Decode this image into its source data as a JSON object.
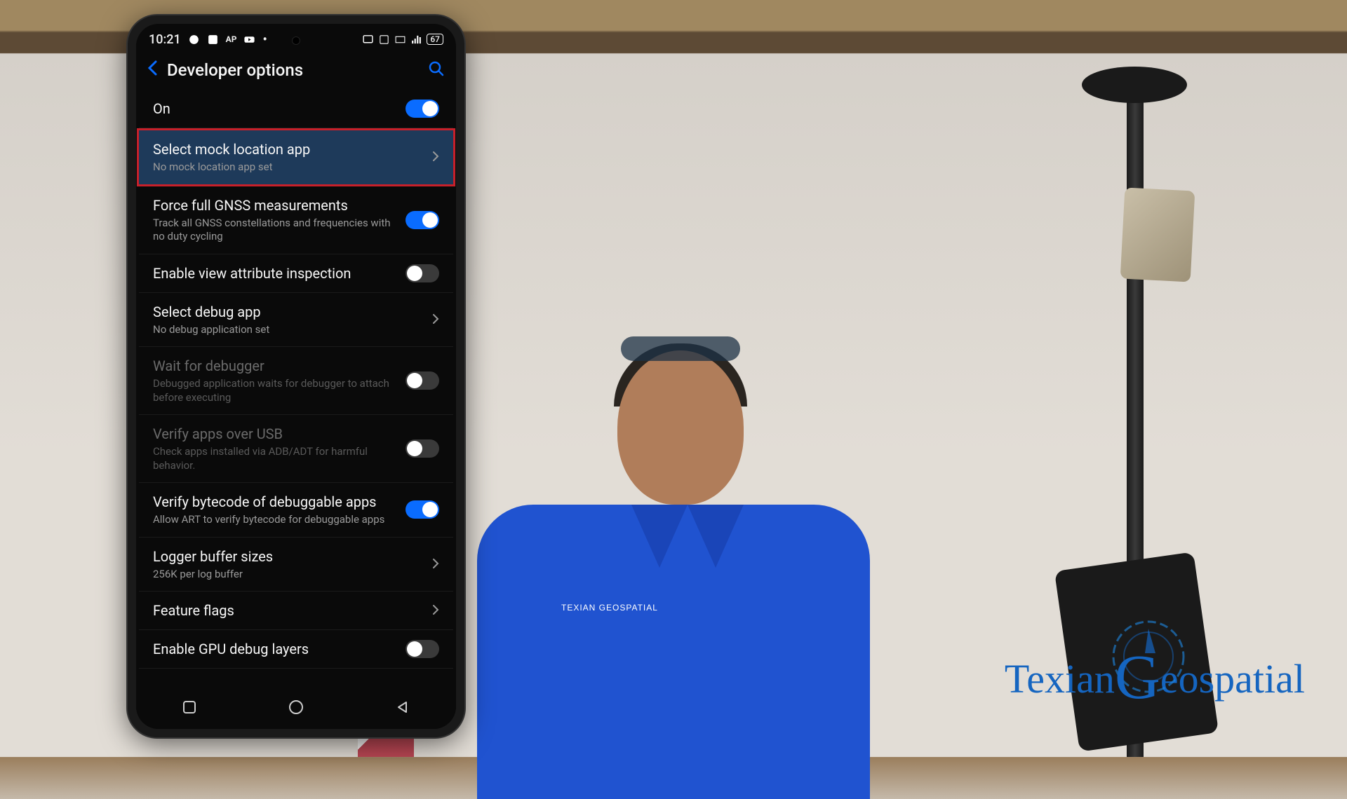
{
  "status_bar": {
    "time": "10:21",
    "battery": "67"
  },
  "header": {
    "title": "Developer options"
  },
  "settings": [
    {
      "title": "On",
      "sub": "",
      "control": "toggle",
      "state": "on",
      "disabled": false,
      "highlight": false
    },
    {
      "title": "Select mock location app",
      "sub": "No mock location app set",
      "control": "chevron",
      "state": "",
      "disabled": false,
      "highlight": true
    },
    {
      "title": "Force full GNSS measurements",
      "sub": "Track all GNSS constellations and frequencies with no duty cycling",
      "control": "toggle",
      "state": "on",
      "disabled": false,
      "highlight": false
    },
    {
      "title": "Enable view attribute inspection",
      "sub": "",
      "control": "toggle",
      "state": "off",
      "disabled": false,
      "highlight": false
    },
    {
      "title": "Select debug app",
      "sub": "No debug application set",
      "control": "chevron",
      "state": "",
      "disabled": false,
      "highlight": false
    },
    {
      "title": "Wait for debugger",
      "sub": "Debugged application waits for debugger to attach before executing",
      "control": "toggle",
      "state": "off",
      "disabled": true,
      "highlight": false
    },
    {
      "title": "Verify apps over USB",
      "sub": "Check apps installed via ADB/ADT for harmful behavior.",
      "control": "toggle",
      "state": "off",
      "disabled": true,
      "highlight": false
    },
    {
      "title": "Verify bytecode of debuggable apps",
      "sub": "Allow ART to verify bytecode for debuggable apps",
      "control": "toggle",
      "state": "on",
      "disabled": false,
      "highlight": false
    },
    {
      "title": "Logger buffer sizes",
      "sub": "256K per log buffer",
      "control": "chevron",
      "state": "",
      "disabled": false,
      "highlight": false
    },
    {
      "title": "Feature flags",
      "sub": "",
      "control": "chevron",
      "state": "",
      "disabled": false,
      "highlight": false
    },
    {
      "title": "Enable GPU debug layers",
      "sub": "",
      "control": "toggle",
      "state": "off",
      "disabled": false,
      "highlight": false
    }
  ],
  "logo": {
    "text_a": "Texian",
    "text_b": "eospatial",
    "big": "G"
  },
  "presenter_shirt_logo": "TEXIAN GEOSPATIAL"
}
